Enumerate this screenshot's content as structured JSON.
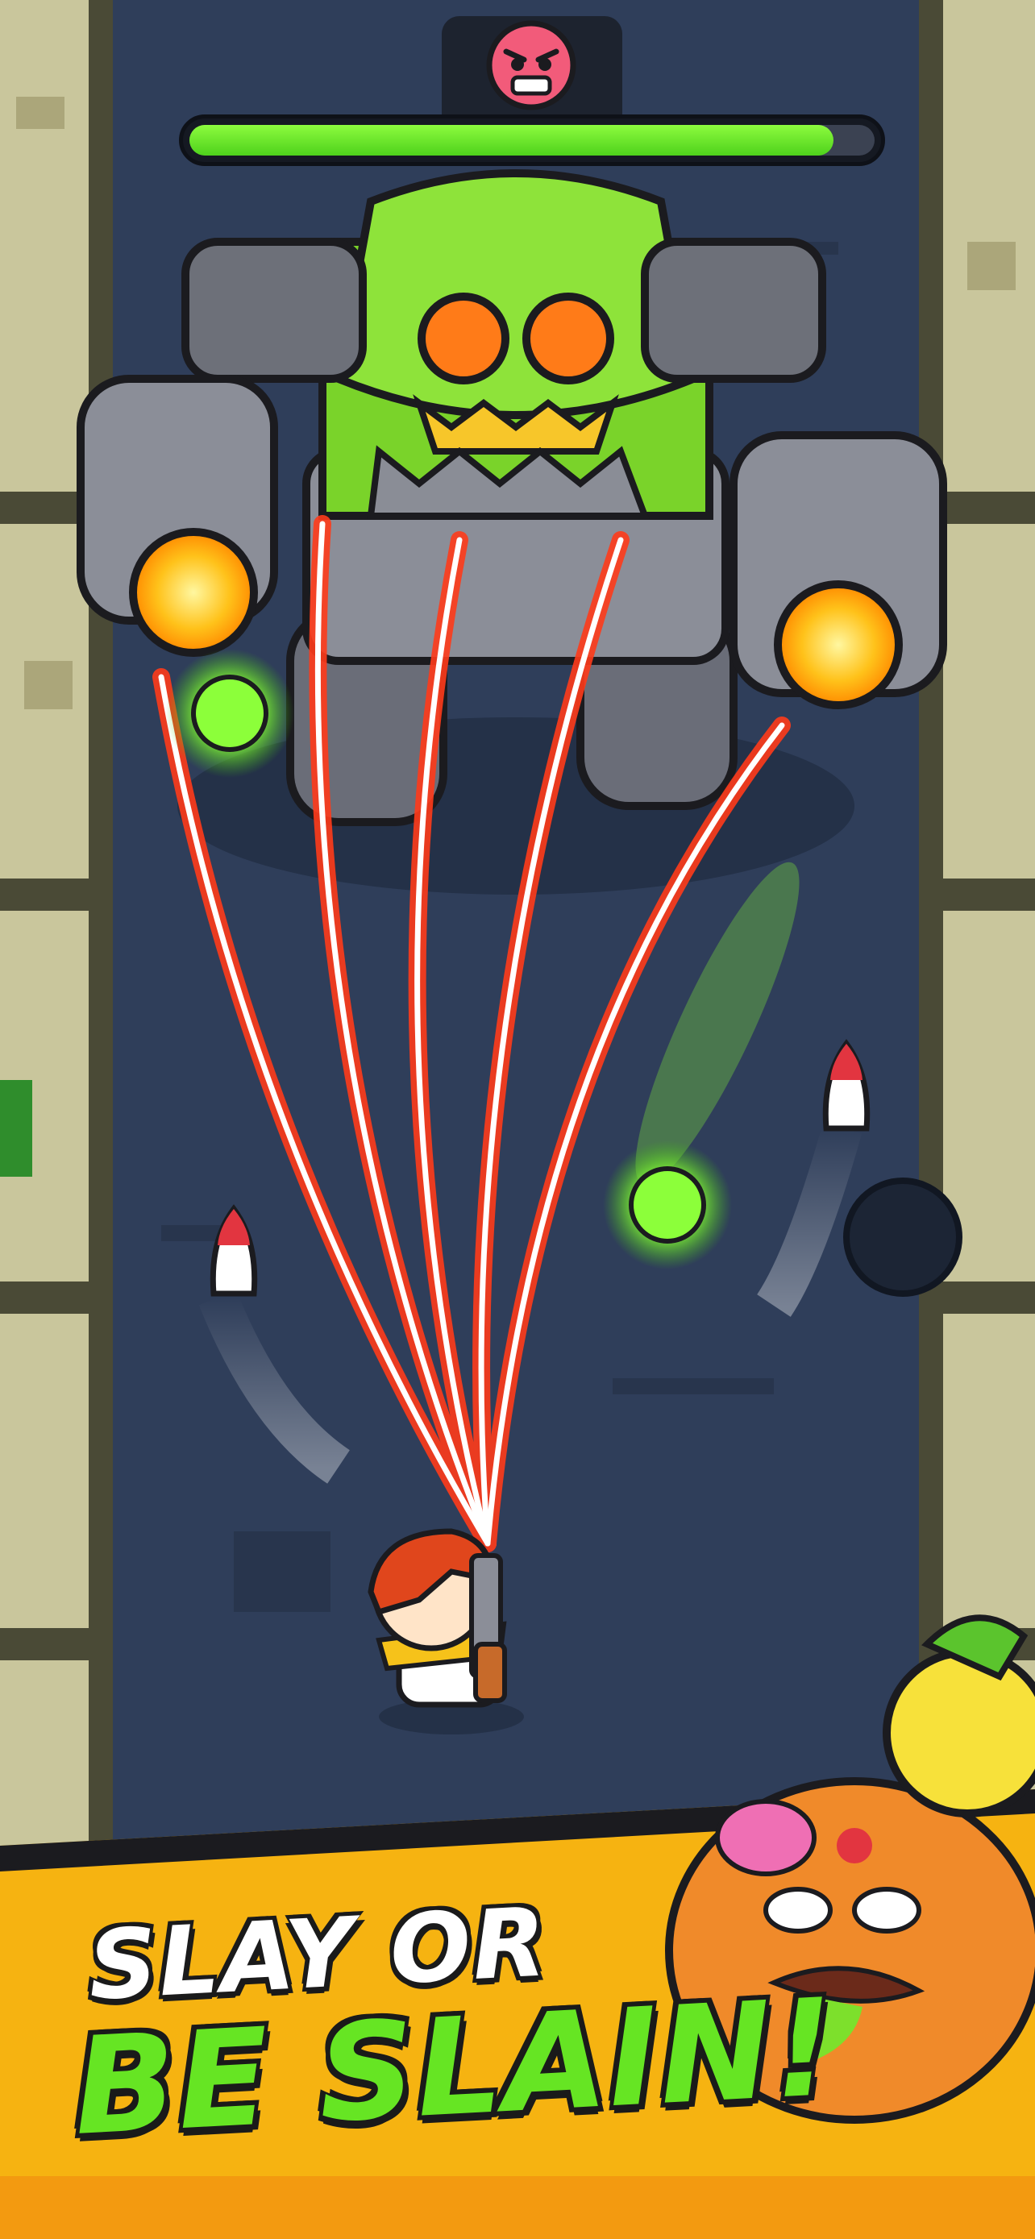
{
  "banner": {
    "line1": "SLAY OR",
    "line2": "BE SLAIN!"
  },
  "boss": {
    "hp_fraction": 0.94,
    "badge_icon": "angry-boss-face-icon"
  },
  "colors": {
    "wall": "#c7c49a",
    "road": "#2f3e5a",
    "hp_green": "#6ee92a",
    "banner_orange": "#f6b311",
    "laser_red": "#ff3b1a",
    "title_green": "#66e523"
  },
  "icons": [
    "angry-boss-face-icon",
    "robot-boss-icon",
    "hero-icon",
    "rocket-icon",
    "green-orb-icon",
    "fruit-monster-icon"
  ]
}
